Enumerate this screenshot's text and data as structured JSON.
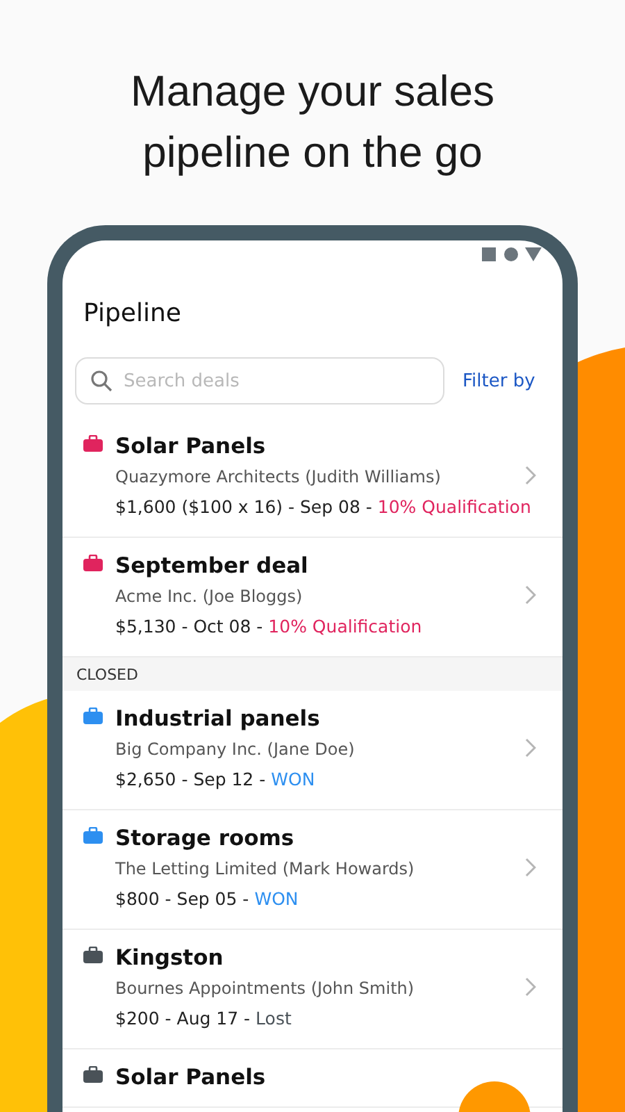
{
  "headline": "Manage your sales pipeline on the go",
  "screen": {
    "title": "Pipeline",
    "search": {
      "placeholder": "Search deals"
    },
    "filter_link": "Filter by"
  },
  "sections": [
    {
      "deals": [
        {
          "title": "Solar Panels",
          "company": "Quazymore Architects (Judith Williams)",
          "details": "$1,600 ($100 x 16) - Sep 08 -",
          "status": "10% Qualification",
          "color": "#e0245e"
        },
        {
          "title": "September deal",
          "company": "Acme Inc. (Joe Bloggs)",
          "details": "$5,130 - Oct 08 -",
          "status": "10% Qualification",
          "color": "#e0245e"
        }
      ]
    },
    {
      "header": "CLOSED",
      "deals": [
        {
          "title": "Industrial panels",
          "company": "Big Company Inc. (Jane Doe)",
          "details": "$2,650 - Sep 12 -",
          "status": "WON",
          "color": "#2d8ff0"
        },
        {
          "title": "Storage rooms",
          "company": "The Letting Limited (Mark Howards)",
          "details": "$800 - Sep 05 -",
          "status": "WON",
          "color": "#2d8ff0"
        },
        {
          "title": "Kingston",
          "company": "Bournes Appointments (John Smith)",
          "details": "$200 - Aug 17 -",
          "status": "Lost",
          "color": "#4a5258"
        },
        {
          "title": "Solar Panels",
          "color": "#4a5258"
        }
      ]
    }
  ]
}
